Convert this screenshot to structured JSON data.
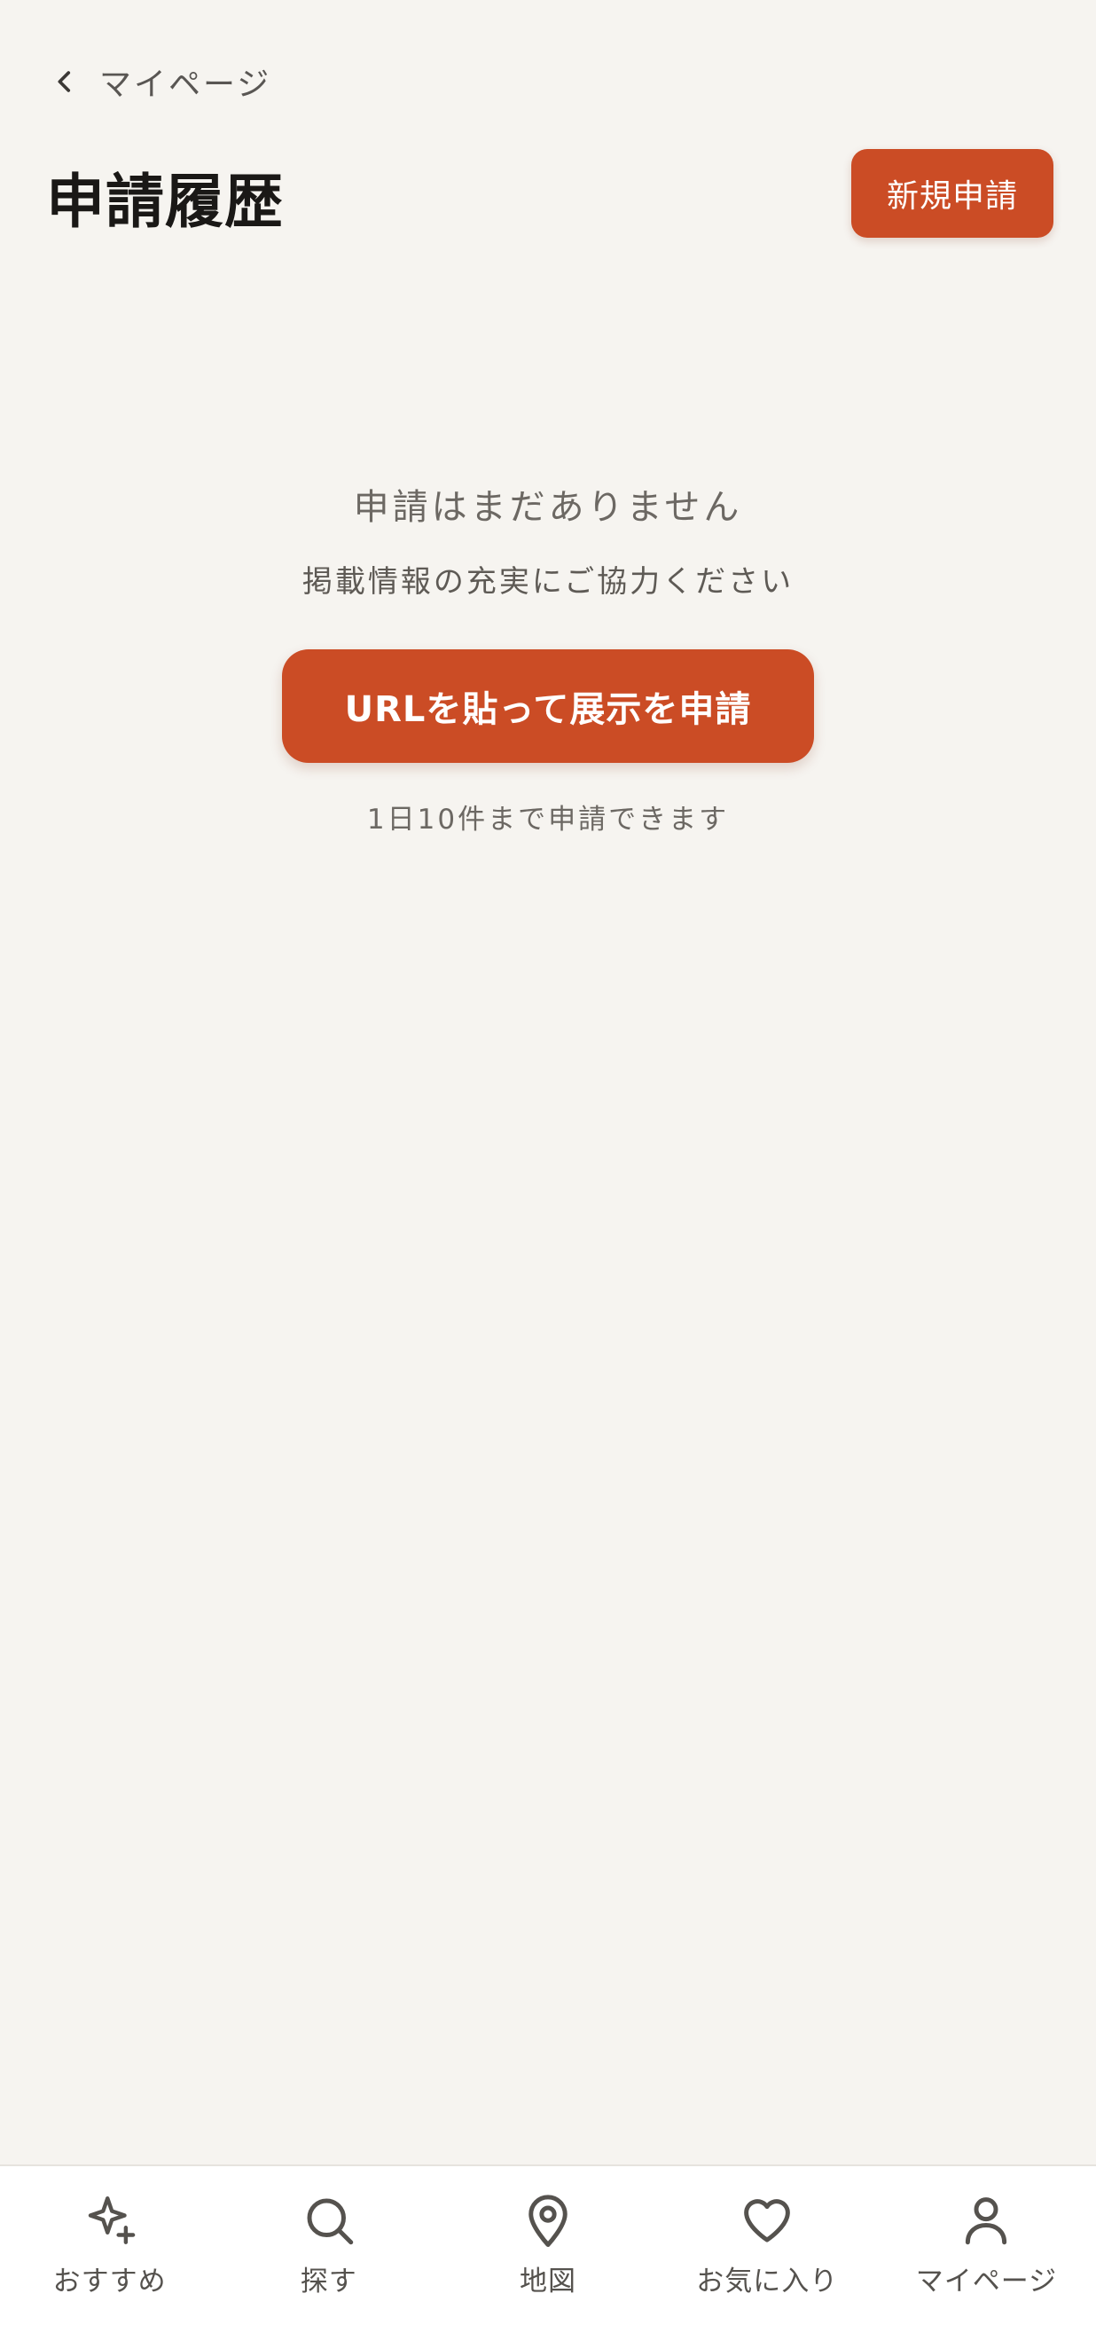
{
  "header": {
    "back_label": "マイページ",
    "title": "申請履歴",
    "new_button_label": "新規申請"
  },
  "empty_state": {
    "title": "申請はまだありません",
    "subtitle": "掲載情報の充実にご協力ください",
    "cta_label": "URLを貼って展示を申請",
    "limit_note": "1日10件まで申請できます"
  },
  "tabbar": {
    "items": [
      {
        "label": "おすすめ",
        "icon": "sparkle-icon"
      },
      {
        "label": "探す",
        "icon": "search-icon"
      },
      {
        "label": "地図",
        "icon": "map-pin-icon"
      },
      {
        "label": "お気に入り",
        "icon": "heart-icon"
      },
      {
        "label": "マイページ",
        "icon": "user-icon"
      }
    ]
  },
  "colors": {
    "background": "#f6f4f0",
    "accent": "#cb4c25",
    "tabbar_background": "#ffffff"
  }
}
